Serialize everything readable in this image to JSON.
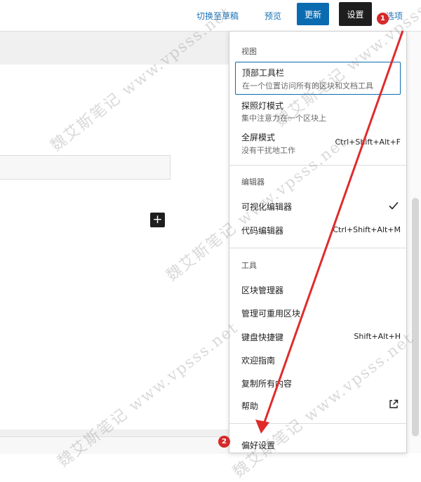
{
  "topbar": {
    "switch_draft": "切换至草稿",
    "preview": "预览",
    "update": "更新",
    "settings": "设置",
    "options": "选项"
  },
  "menu": {
    "view": {
      "heading": "视图",
      "items": [
        {
          "label": "顶部工具栏",
          "desc": "在一个位置访问所有的区块和文档工具"
        },
        {
          "label": "探照灯模式",
          "desc": "集中注意力在一个区块上"
        },
        {
          "label": "全屏模式",
          "desc": "没有干扰地工作",
          "shortcut": "Ctrl+Shift+Alt+F"
        }
      ]
    },
    "editor": {
      "heading": "编辑器",
      "items": [
        {
          "label": "可视化编辑器",
          "checked": true
        },
        {
          "label": "代码编辑器",
          "shortcut": "Ctrl+Shift+Alt+M"
        }
      ]
    },
    "tools": {
      "heading": "工具",
      "items": [
        {
          "label": "区块管理器"
        },
        {
          "label": "管理可重用区块"
        },
        {
          "label": "键盘快捷键",
          "shortcut": "Shift+Alt+H"
        },
        {
          "label": "欢迎指南"
        },
        {
          "label": "复制所有内容"
        },
        {
          "label": "帮助",
          "icon": "external-link-icon"
        }
      ]
    },
    "preferences": {
      "label": "偏好设置"
    }
  },
  "annotations": {
    "badge1": "1",
    "badge2": "2"
  },
  "watermark": {
    "cn": "魏艾斯笔记",
    "url": "www.vpsss.net"
  },
  "colors": {
    "accent": "#0b6bb0",
    "annotation": "#d62a2a",
    "dark": "#1e1e1e"
  },
  "editor_canvas": {
    "inserter_icon": "plus-icon"
  }
}
